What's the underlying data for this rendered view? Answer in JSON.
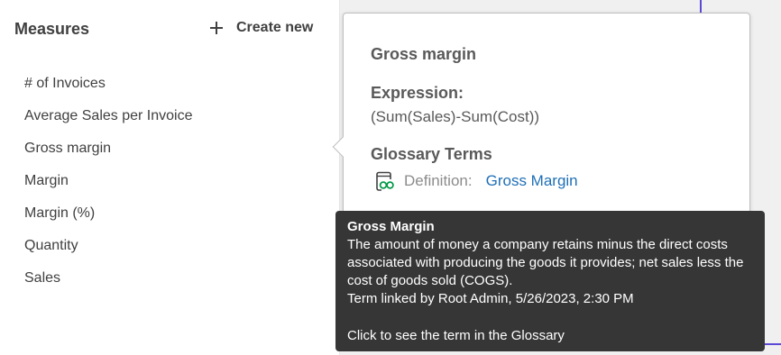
{
  "measures_panel": {
    "title": "Measures",
    "create_new_label": "Create new",
    "items": [
      "# of Invoices",
      "Average Sales per Invoice",
      "Gross margin",
      "Margin",
      "Margin (%)",
      "Quantity",
      "Sales"
    ]
  },
  "popover": {
    "title": "Gross margin",
    "expression_label": "Expression:",
    "expression_value": "(Sum(Sales)-Sum(Cost))",
    "glossary_label": "Glossary Terms",
    "definition_label": "Definition:",
    "definition_link": "Gross Margin",
    "icon": "glossary-icon"
  },
  "tooltip": {
    "title": "Gross Margin",
    "description": "The amount of money a company retains minus the direct costs associated with producing the goods it provides; net sales less the cost of goods sold (COGS).",
    "linked_by": "Term linked by Root Admin, 5/26/2023, 2:30 PM",
    "cta": "Click to see the term in the Glossary"
  },
  "colors": {
    "panel_bg": "#ffffff",
    "page_bg": "#f0f0f0",
    "text": "#404040",
    "link": "#1f6fb5",
    "tooltip_bg": "#363636",
    "glossary_icon": "#009845",
    "accent": "#5b4ad6"
  }
}
